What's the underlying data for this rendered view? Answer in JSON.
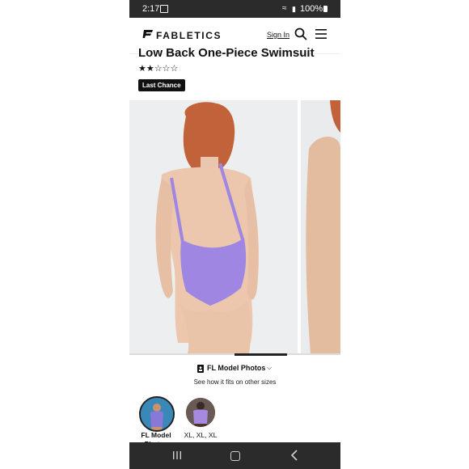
{
  "statusbar": {
    "time": "2:17",
    "battery_text": "100%"
  },
  "header": {
    "brand": "FABLETICS",
    "signin_label": "Sign In",
    "icons": [
      "logo-icon",
      "search-icon",
      "menu-icon"
    ]
  },
  "product": {
    "title": "Low Back One-Piece Swimsuit",
    "stars": "★★☆☆☆",
    "rating": 2,
    "rating_max": 5,
    "badge": "Last Chance"
  },
  "gallery": {
    "swimsuit_color": "#9f86e3",
    "progress": 0.5
  },
  "model_photos": {
    "label": "FL Model Photos",
    "subtitle": "See how it fits on other sizes",
    "thumbnails": [
      {
        "label": "FL Model Photos",
        "selected": true
      },
      {
        "label": "XL, XL, XL",
        "selected": false
      }
    ]
  },
  "navbar": {
    "icons": [
      "recents-icon",
      "home-icon",
      "back-icon"
    ]
  }
}
